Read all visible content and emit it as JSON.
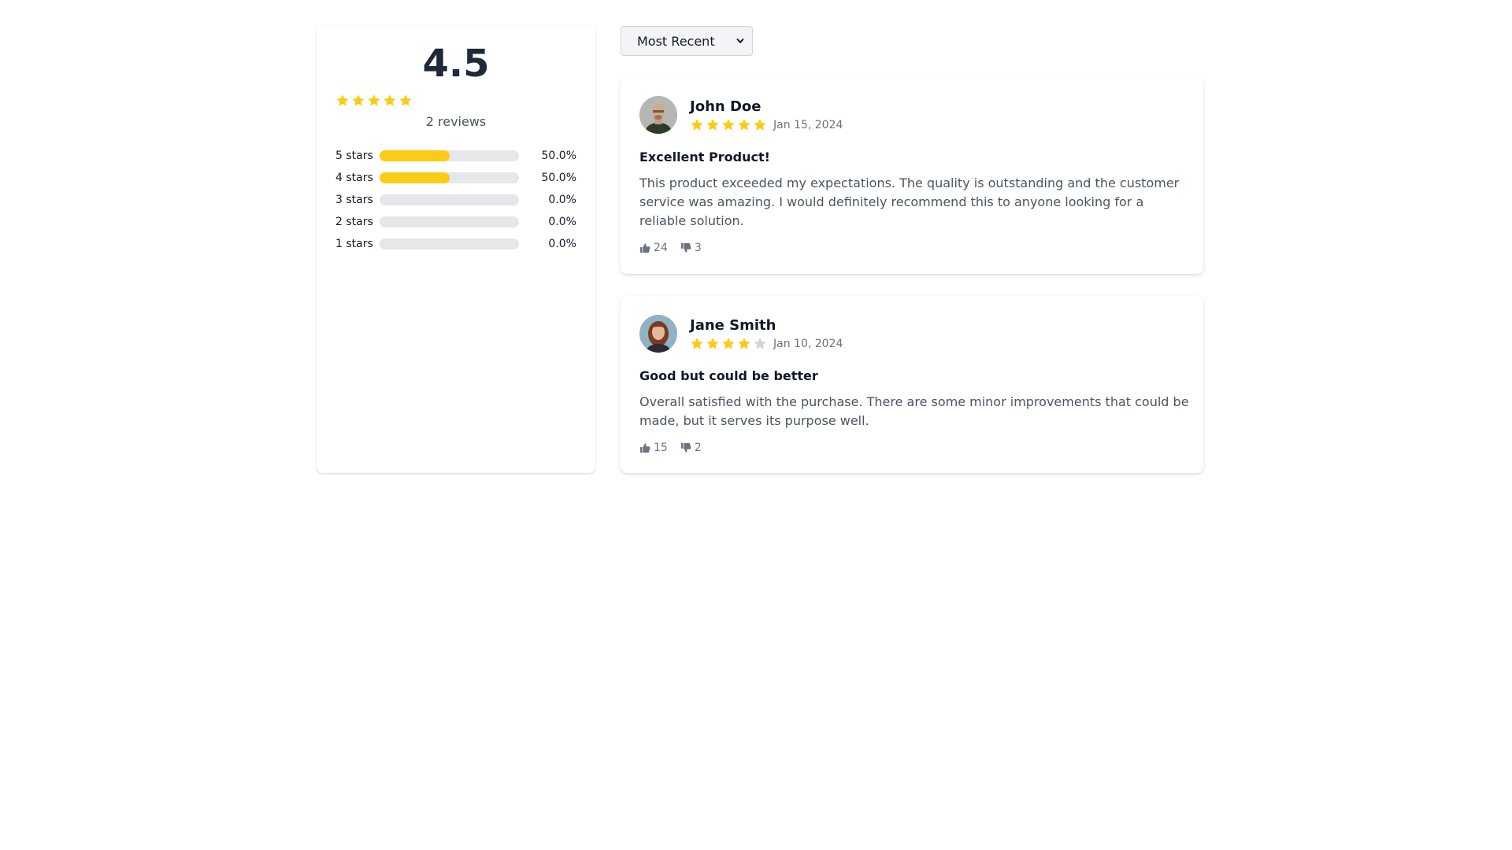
{
  "summary": {
    "average": "4.5",
    "average_value": 4.5,
    "review_count": "2 reviews",
    "distribution": [
      {
        "label": "5 stars",
        "percent_text": "50.0%",
        "fraction": 0.5
      },
      {
        "label": "4 stars",
        "percent_text": "50.0%",
        "fraction": 0.5
      },
      {
        "label": "3 stars",
        "percent_text": "0.0%",
        "fraction": 0.0
      },
      {
        "label": "2 stars",
        "percent_text": "0.0%",
        "fraction": 0.0
      },
      {
        "label": "1 stars",
        "percent_text": "0.0%",
        "fraction": 0.0
      }
    ]
  },
  "sort": {
    "selected": "Most Recent"
  },
  "reviews": [
    {
      "name": "John Doe",
      "rating": 5,
      "date": "Jan 15, 2024",
      "title": "Excellent Product!",
      "body": "This product exceeded my expectations. The quality is outstanding and the customer service was amazing. I would definitely recommend this to anyone looking for a reliable solution.",
      "helpful": "24",
      "not_helpful": "3"
    },
    {
      "name": "Jane Smith",
      "rating": 4,
      "date": "Jan 10, 2024",
      "title": "Good but could be better",
      "body": "Overall satisfied with the purchase. There are some minor improvements that could be made, but it serves its purpose well.",
      "helpful": "15",
      "not_helpful": "2"
    }
  ],
  "colors": {
    "star_filled": "#facc15",
    "star_empty": "#d1d5db",
    "bar_track": "#e5e7eb"
  },
  "icons": {
    "star": "star-icon",
    "thumbs_up": "thumbs-up-icon",
    "thumbs_down": "thumbs-down-icon",
    "dropdown": "chevron-down-icon"
  }
}
